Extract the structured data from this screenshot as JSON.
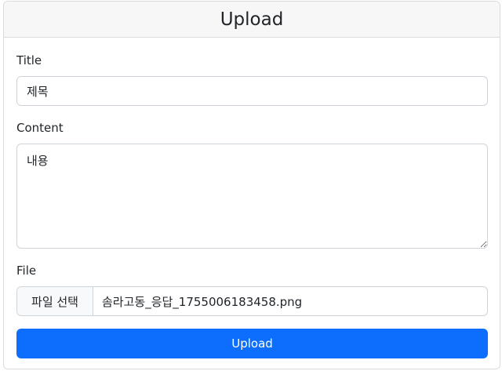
{
  "header": {
    "title": "Upload"
  },
  "form": {
    "title_label": "Title",
    "title_value": "제목",
    "content_label": "Content",
    "content_value": "내용",
    "file_label": "File",
    "file_button_label": "파일 선택",
    "file_name": "솜라고동_응답_1755006183458.png",
    "submit_label": "Upload"
  },
  "colors": {
    "primary": "#0d6efd",
    "header_bg": "#f7f7f7",
    "border": "#ced4da"
  }
}
